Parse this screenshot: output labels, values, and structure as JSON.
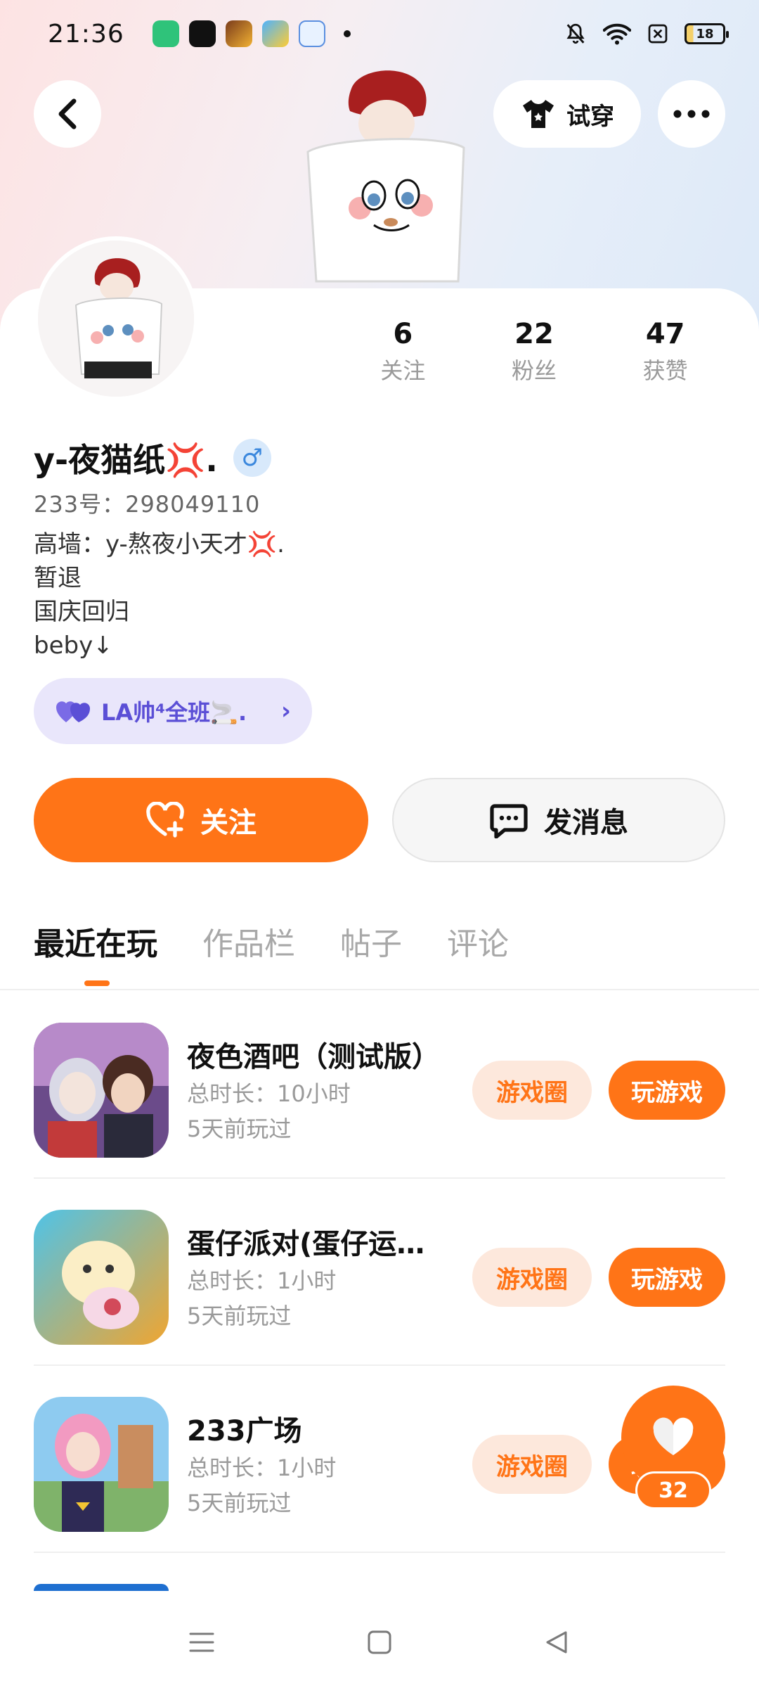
{
  "status_bar": {
    "time": "21:36",
    "battery": "18"
  },
  "header": {
    "try_on_label": "试穿"
  },
  "profile": {
    "stats": [
      {
        "value": "6",
        "label": "关注"
      },
      {
        "value": "22",
        "label": "粉丝"
      },
      {
        "value": "47",
        "label": "获赞"
      }
    ],
    "name": "y-夜猫纸💢.",
    "gender_symbol": "♂",
    "id_line": "233号：298049110",
    "bio_lines": [
      "高墙：y-熬夜小天才💢.",
      "暂退",
      "国庆回归",
      "beby↓"
    ],
    "tag_chip": "LA帅⁴全班🚬."
  },
  "actions": {
    "follow_label": "关注",
    "message_label": "发消息"
  },
  "tabs": [
    {
      "label": "最近在玩",
      "active": true
    },
    {
      "label": "作品栏",
      "active": false
    },
    {
      "label": "帖子",
      "active": false
    },
    {
      "label": "评论",
      "active": false
    }
  ],
  "games": [
    {
      "title": "夜色酒吧（测试版）",
      "duration": "总时长：10小时",
      "last_played": "5天前玩过",
      "circle_label": "游戏圈",
      "play_label": "玩游戏"
    },
    {
      "title": "蛋仔派对(蛋仔运…",
      "duration": "总时长：1小时",
      "last_played": "5天前玩过",
      "circle_label": "游戏圈",
      "play_label": "玩游戏"
    },
    {
      "title": "233广场",
      "duration": "总时长：1小时",
      "last_played": "5天前玩过",
      "circle_label": "游戏圈",
      "play_label": "玩游戏"
    }
  ],
  "like_fab": {
    "count": "32"
  },
  "colors": {
    "accent": "#ff7417",
    "accent_light": "#fde8dc",
    "chip_bg": "#e9e6fb",
    "chip_text": "#5b4fd6"
  }
}
